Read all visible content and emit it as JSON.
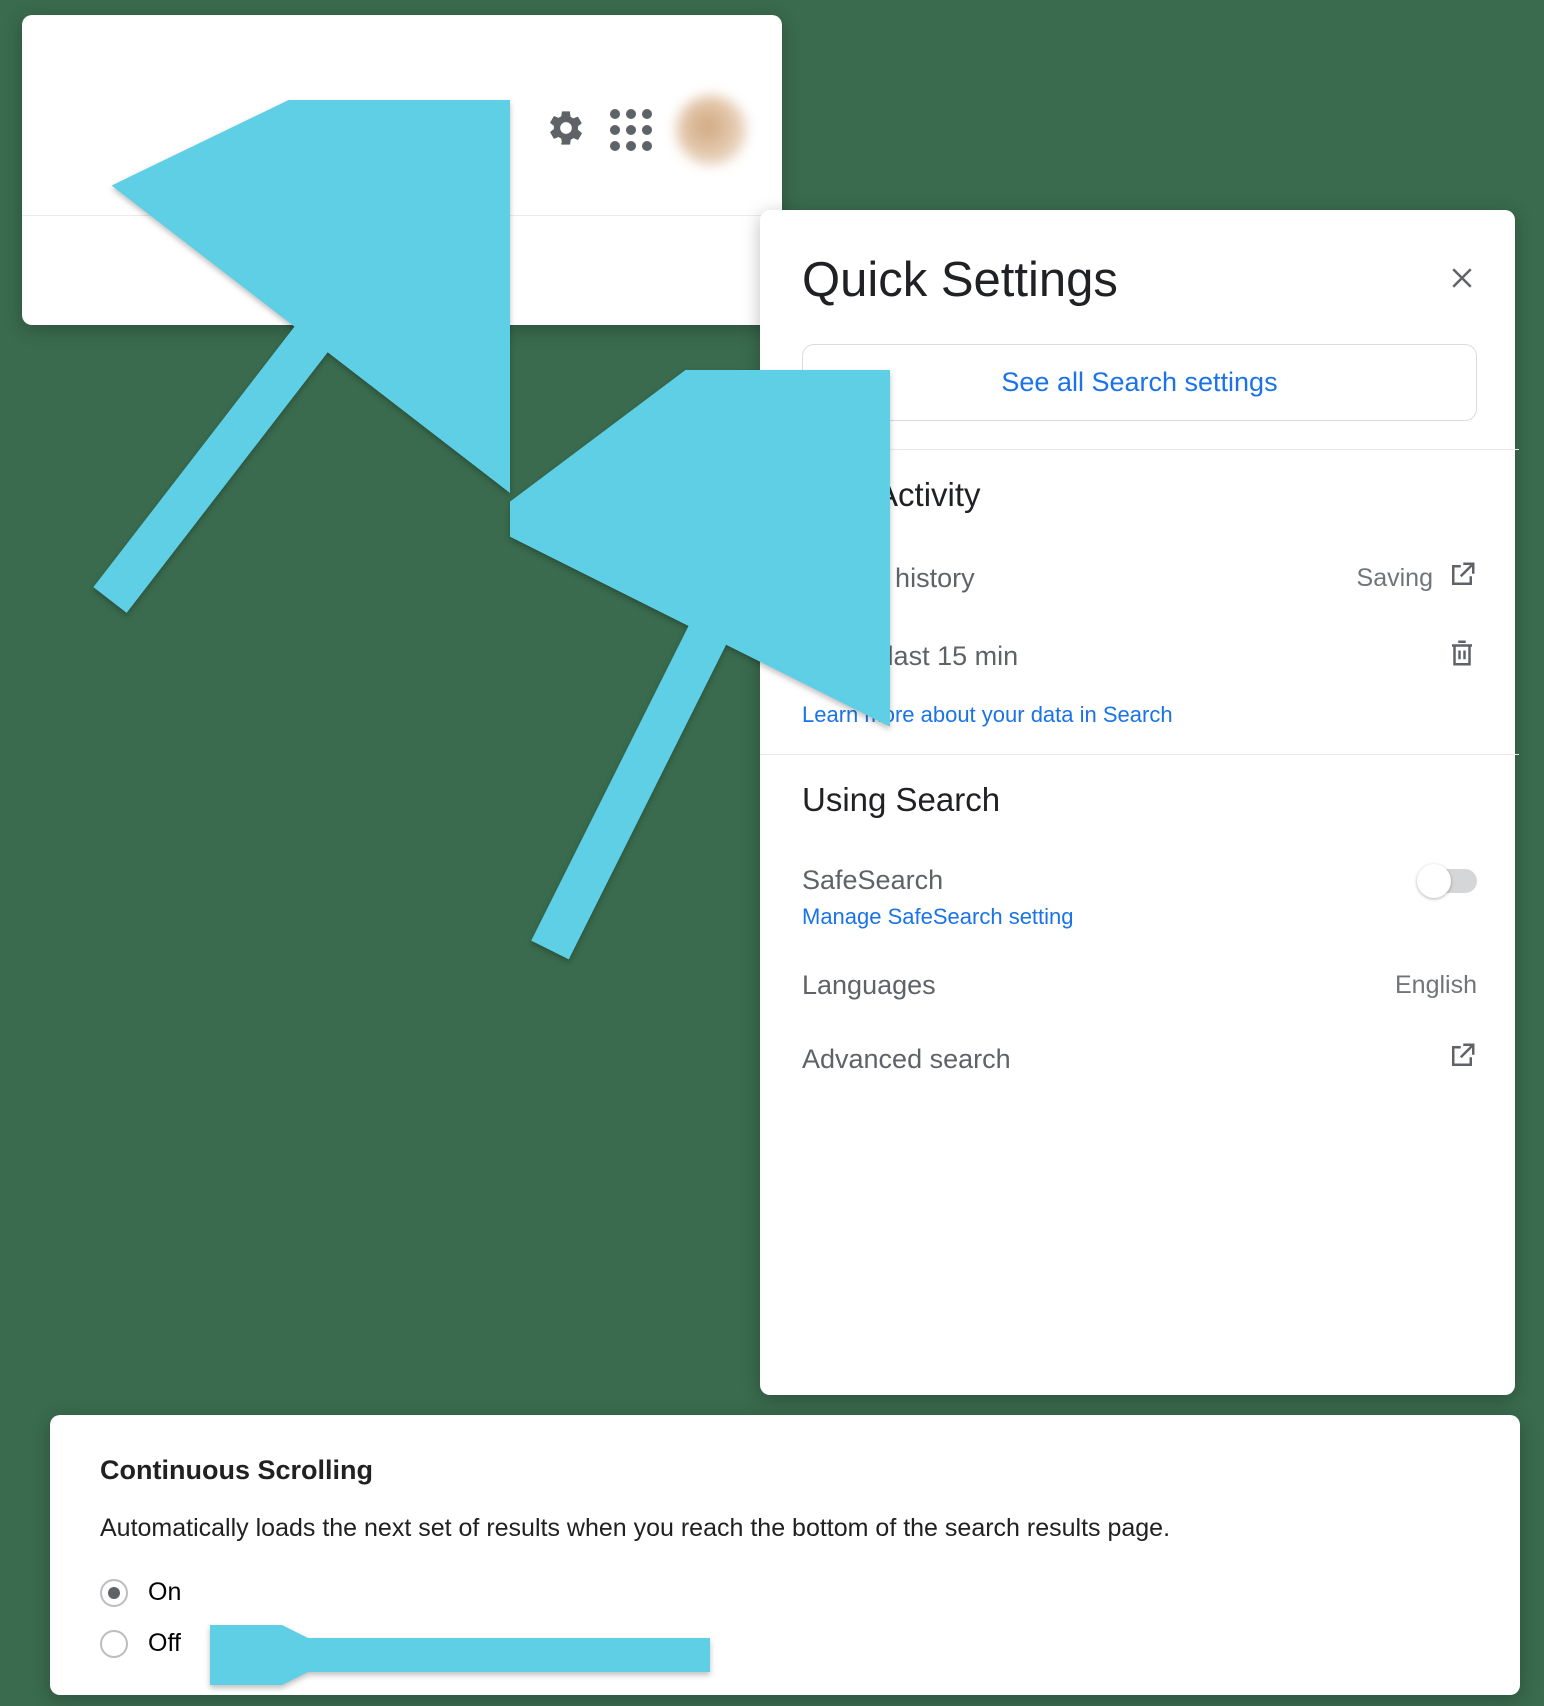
{
  "toolbar": {
    "gear_icon": "settings-gear",
    "apps_icon": "apps-grid",
    "avatar": "user-avatar"
  },
  "quick_settings": {
    "title": "Quick Settings",
    "see_all_button": "See all Search settings",
    "sections": {
      "activity": {
        "heading": "Your Activity",
        "search_history": {
          "label": "Search history",
          "status": "Saving"
        },
        "delete_last": {
          "label": "Delete last 15 min"
        },
        "learn_more_link": "Learn more about your data in Search"
      },
      "using_search": {
        "heading": "Using Search",
        "safesearch": {
          "label": "SafeSearch",
          "manage_link": "Manage SafeSearch setting",
          "toggle": false
        },
        "languages": {
          "label": "Languages",
          "value": "English"
        },
        "advanced": {
          "label": "Advanced search"
        }
      }
    }
  },
  "continuous_scrolling": {
    "title": "Continuous Scrolling",
    "description": "Automatically loads the next set of results when you reach the bottom of the search results page.",
    "options": {
      "on": "On",
      "off": "Off",
      "selected": "On"
    }
  },
  "annotations": {
    "arrow_color": "#5ecfe5"
  }
}
